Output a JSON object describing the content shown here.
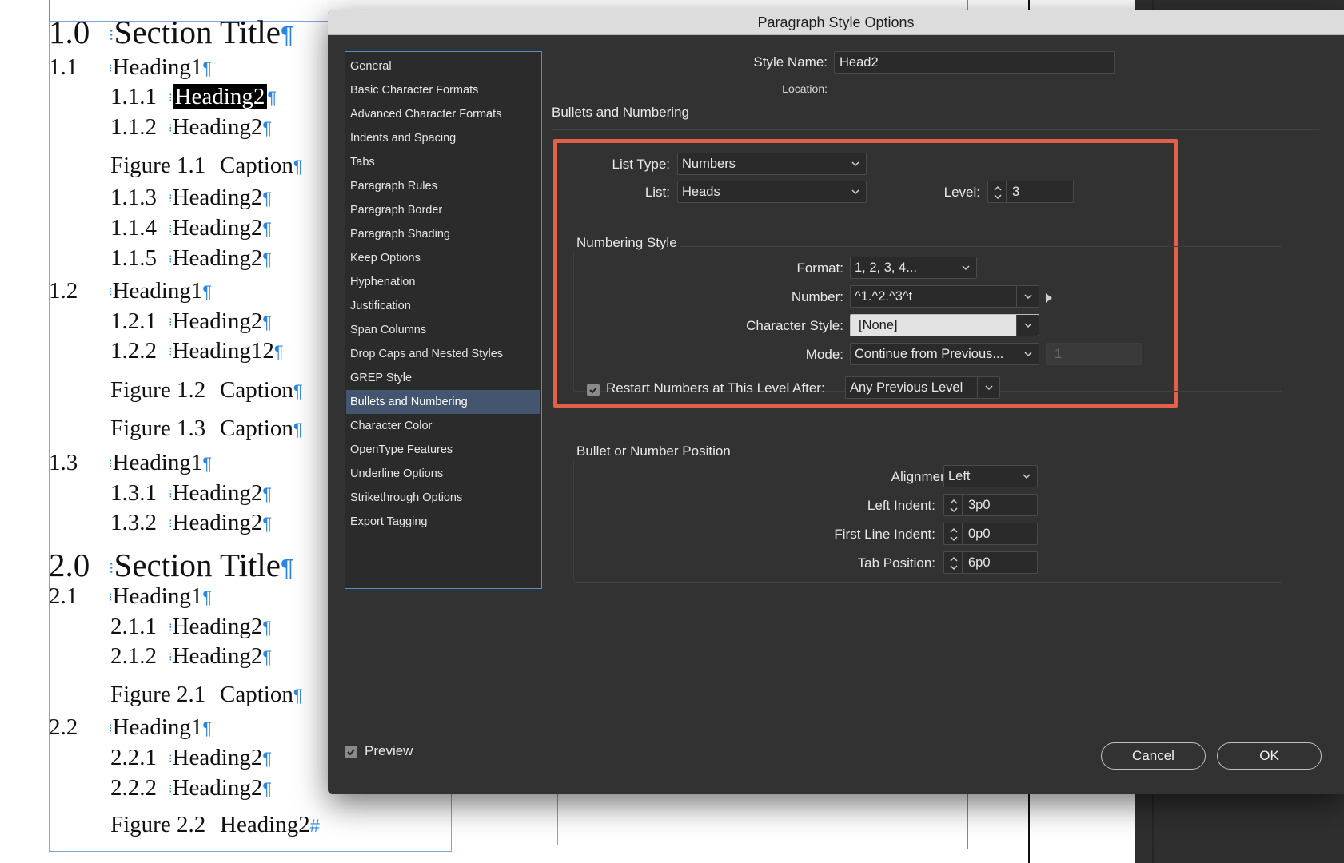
{
  "document": {
    "lines": [
      {
        "cls": "sec",
        "num": "1.0",
        "text": "Section Title",
        "mark": "¶"
      },
      {
        "cls": "h1",
        "num": "1.1",
        "text": "Heading1",
        "mark": "¶"
      },
      {
        "cls": "h2",
        "num": "1.1.1",
        "text": "Heading2",
        "mark": "¶"
      },
      {
        "cls": "h2",
        "num": "1.1.2",
        "text": "Heading2",
        "mark": "¶"
      },
      {
        "cls": "fig",
        "num": "Figure 1.1",
        "text": "Caption",
        "mark": "¶"
      },
      {
        "cls": "h2",
        "num": "1.1.3",
        "text": "Heading2",
        "mark": "¶"
      },
      {
        "cls": "h2",
        "num": "1.1.4",
        "text": "Heading2",
        "mark": "¶"
      },
      {
        "cls": "h2",
        "num": "1.1.5",
        "text": "Heading2",
        "mark": "¶"
      },
      {
        "cls": "h1",
        "num": "1.2",
        "text": "Heading1",
        "mark": "¶"
      },
      {
        "cls": "h2",
        "num": "1.2.1",
        "text": "Heading2",
        "mark": "¶"
      },
      {
        "cls": "h2",
        "num": "1.2.2",
        "text": "Heading12",
        "mark": "¶"
      },
      {
        "cls": "fig",
        "num": "Figure 1.2",
        "text": "Caption",
        "mark": "¶"
      },
      {
        "cls": "fig",
        "num": "Figure 1.3",
        "text": "Caption",
        "mark": "¶"
      },
      {
        "cls": "h1",
        "num": "1.3",
        "text": "Heading1",
        "mark": "¶"
      },
      {
        "cls": "h2",
        "num": "1.3.1",
        "text": "Heading2",
        "mark": "¶"
      },
      {
        "cls": "h2",
        "num": "1.3.2",
        "text": "Heading2",
        "mark": "¶"
      },
      {
        "cls": "sec",
        "num": "2.0",
        "text": "Section Title",
        "mark": "¶"
      },
      {
        "cls": "h1",
        "num": "2.1",
        "text": "Heading1",
        "mark": "¶"
      },
      {
        "cls": "h2",
        "num": "2.1.1",
        "text": "Heading2",
        "mark": "¶"
      },
      {
        "cls": "h2",
        "num": "2.1.2",
        "text": "Heading2",
        "mark": "¶"
      },
      {
        "cls": "fig",
        "num": "Figure 2.1",
        "text": "Caption",
        "mark": "¶"
      },
      {
        "cls": "h1",
        "num": "2.2",
        "text": "Heading1",
        "mark": "¶"
      },
      {
        "cls": "h2",
        "num": "2.2.1",
        "text": "Heading2",
        "mark": "¶"
      },
      {
        "cls": "h2",
        "num": "2.2.2",
        "text": "Heading2",
        "mark": "¶"
      },
      {
        "cls": "fig",
        "num": "Figure 2.2",
        "text": "Heading2",
        "mark": "#"
      }
    ]
  },
  "dialog": {
    "title": "Paragraph Style Options",
    "sidebar": [
      {
        "label": "General"
      },
      {
        "label": "Basic Character Formats"
      },
      {
        "label": "Advanced Character Formats"
      },
      {
        "label": "Indents and Spacing"
      },
      {
        "label": "Tabs"
      },
      {
        "label": "Paragraph Rules"
      },
      {
        "label": "Paragraph Border"
      },
      {
        "label": "Paragraph Shading"
      },
      {
        "label": "Keep Options"
      },
      {
        "label": "Hyphenation"
      },
      {
        "label": "Justification"
      },
      {
        "label": "Span Columns"
      },
      {
        "label": "Drop Caps and Nested Styles"
      },
      {
        "label": "GREP Style"
      },
      {
        "label": "Bullets and Numbering",
        "active": true
      },
      {
        "label": "Character Color"
      },
      {
        "label": "OpenType Features"
      },
      {
        "label": "Underline Options"
      },
      {
        "label": "Strikethrough Options"
      },
      {
        "label": "Export Tagging"
      }
    ],
    "style_name_label": "Style Name:",
    "style_name_value": "Head2",
    "location_label": "Location:",
    "section_title": "Bullets and Numbering",
    "list_type_label": "List Type:",
    "list_type_value": "Numbers",
    "list_label": "List:",
    "list_value": "Heads",
    "level_label": "Level:",
    "level_value": "3",
    "numbering_style_title": "Numbering Style",
    "format_label": "Format:",
    "format_value": "1, 2, 3, 4...",
    "number_label": "Number:",
    "number_value": "^1.^2.^3^t",
    "char_style_label": "Character Style:",
    "char_style_value": "[None]",
    "mode_label": "Mode:",
    "mode_value": "Continue from Previous...",
    "mode_start_value": "1",
    "restart_label": "Restart Numbers at This Level After:",
    "restart_checked": true,
    "restart_value": "Any Previous Level",
    "position_title": "Bullet or Number Position",
    "alignment_label": "Alignment:",
    "alignment_value": "Left",
    "left_indent_label": "Left Indent:",
    "left_indent_value": "3p0",
    "first_line_label": "First Line Indent:",
    "first_line_value": "0p0",
    "tab_position_label": "Tab Position:",
    "tab_position_value": "6p0",
    "preview_label": "Preview",
    "preview_checked": true,
    "cancel_label": "Cancel",
    "ok_label": "OK",
    "colors": {
      "highlight": "#e4604a",
      "selection": "#44566f",
      "focus": "#4d8fd6"
    }
  }
}
